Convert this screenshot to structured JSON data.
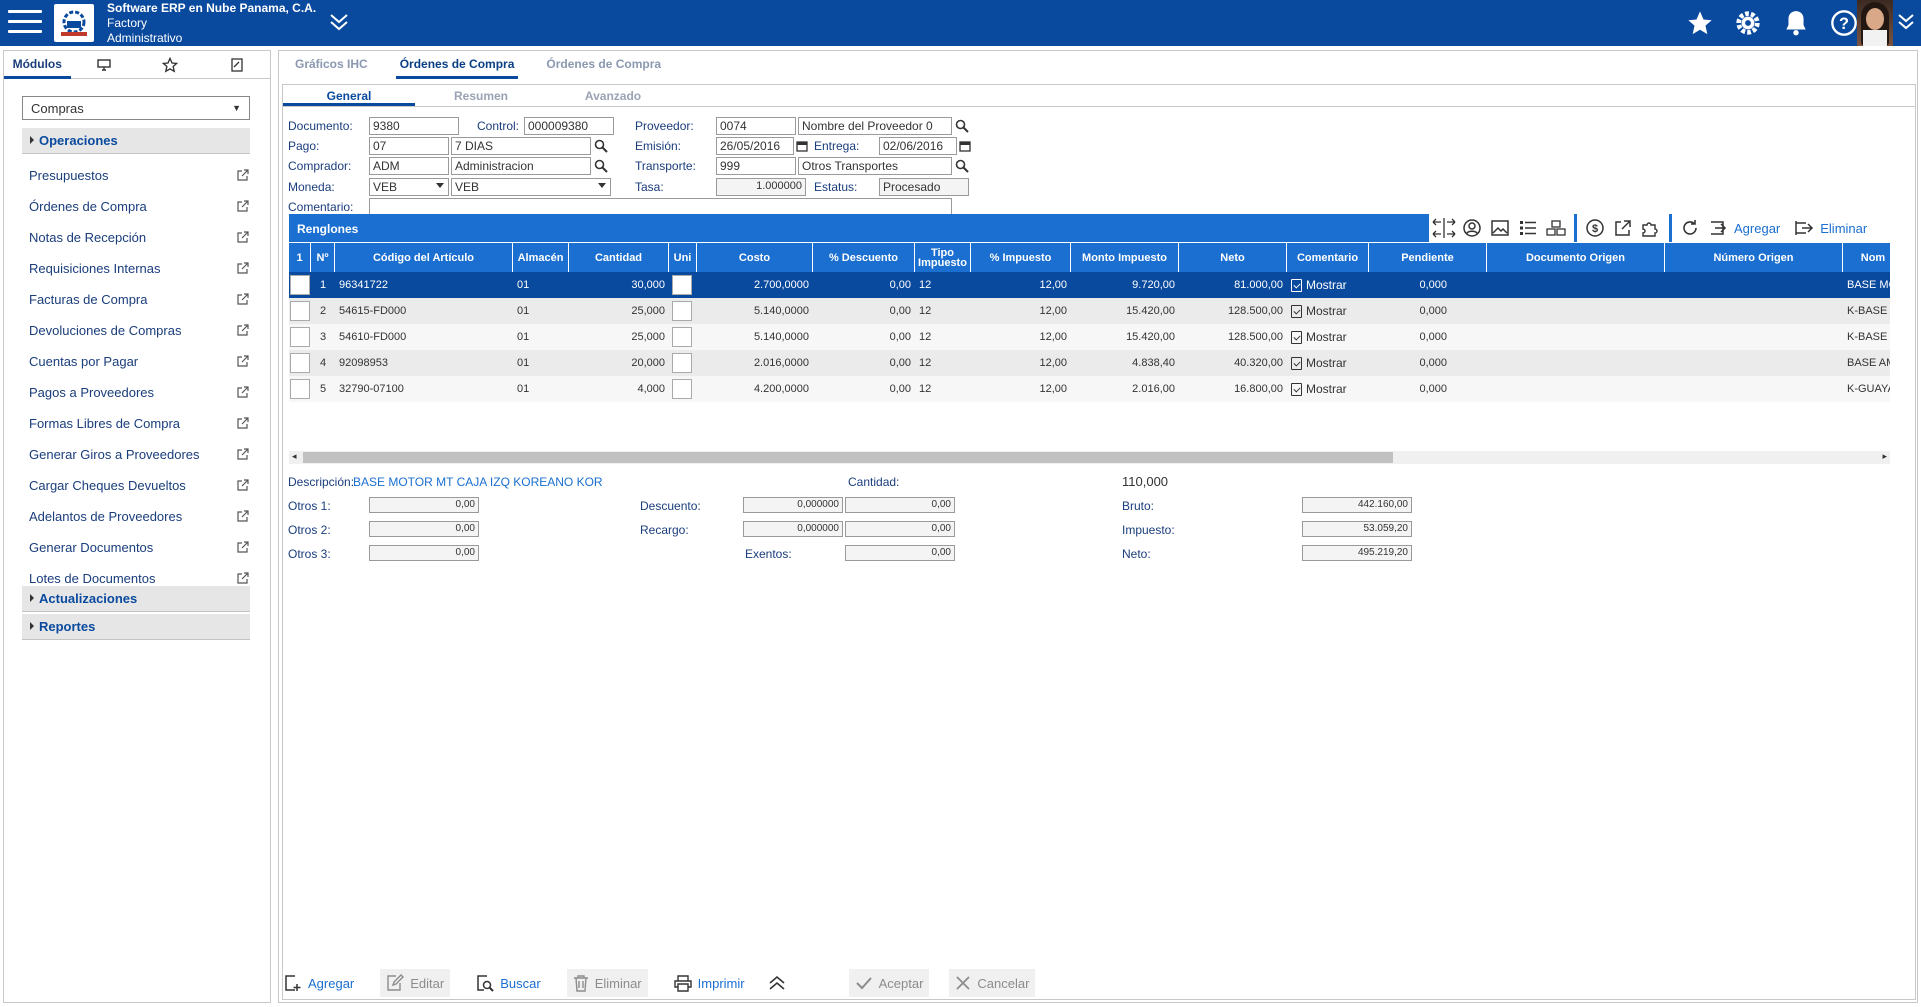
{
  "header": {
    "company": "Software ERP en Nube Panama, C.A.",
    "factory": "Factory",
    "role": "Administrativo"
  },
  "sidebar": {
    "tabs": [
      "Módulos",
      "monitor-icon",
      "star-icon",
      "notes-icon"
    ],
    "module": "Compras",
    "sections": [
      "Operaciones",
      "Actualizaciones",
      "Reportes"
    ],
    "items": [
      "Presupuestos",
      "Órdenes de Compra",
      "Notas de Recepción",
      "Requisiciones Internas",
      "Facturas de Compra",
      "Devoluciones de Compras",
      "Cuentas por Pagar",
      "Pagos a Proveedores",
      "Formas Libres de Compra",
      "Generar Giros a Proveedores",
      "Cargar Cheques Devueltos",
      "Adelantos de Proveedores",
      "Generar Documentos",
      "Lotes de Documentos"
    ]
  },
  "main_tabs": [
    "Gráficos IHC",
    "Órdenes de Compra",
    "Órdenes de Compra"
  ],
  "sub_tabs": [
    "General",
    "Resumen",
    "Avanzado"
  ],
  "form": {
    "documento_label": "Documento:",
    "documento": "9380",
    "control_label": "Control:",
    "control": "000009380",
    "proveedor_label": "Proveedor:",
    "proveedor_code": "0074",
    "proveedor_name": "Nombre del Proveedor 0",
    "pago_label": "Pago:",
    "pago_code": "07",
    "pago_desc": "7 DIAS",
    "emision_label": "Emisión:",
    "emision": "26/05/2016",
    "entrega_label": "Entrega:",
    "entrega": "02/06/2016",
    "comprador_label": "Comprador:",
    "comprador_code": "ADM",
    "comprador_name": "Administracion",
    "transporte_label": "Transporte:",
    "transporte_code": "999",
    "transporte_name": "Otros Transportes",
    "moneda_label": "Moneda:",
    "moneda_code": "VEB",
    "moneda_name": "VEB",
    "tasa_label": "Tasa:",
    "tasa": "1.000000",
    "estatus_label": "Estatus:",
    "estatus": "Procesado",
    "comentario_label": "Comentario:",
    "comentario": ""
  },
  "grid": {
    "title": "Renglones",
    "toolbar": {
      "agregar": "Agregar",
      "eliminar": "Eliminar"
    },
    "columns": [
      "1",
      "Nº",
      "Código del Artículo",
      "Almacén",
      "Cantidad",
      "Uni",
      "Costo",
      "% Descuento",
      "Tipo Impuesto",
      "% Impuesto",
      "Monto Impuesto",
      "Neto",
      "Comentario",
      "Pendiente",
      "Documento Origen",
      "Número Origen",
      "Nom"
    ],
    "rows": [
      {
        "n": "1",
        "codigo": "96341722",
        "almacen": "01",
        "cantidad": "30,000",
        "costo": "2.700,0000",
        "descuento": "0,00",
        "tipo": "12",
        "impuesto": "12,00",
        "monto": "9.720,00",
        "neto": "81.000,00",
        "comentario": "Mostrar",
        "pendiente": "0,000",
        "nombre": "BASE MOTOR"
      },
      {
        "n": "2",
        "codigo": "54615-FD000",
        "almacen": "01",
        "cantidad": "25,000",
        "costo": "5.140,0000",
        "descuento": "0,00",
        "tipo": "12",
        "impuesto": "12,00",
        "monto": "15.420,00",
        "neto": "128.500,00",
        "comentario": "Mostrar",
        "pendiente": "0,000",
        "nombre": "K-BASE AMOR"
      },
      {
        "n": "3",
        "codigo": "54610-FD000",
        "almacen": "01",
        "cantidad": "25,000",
        "costo": "5.140,0000",
        "descuento": "0,00",
        "tipo": "12",
        "impuesto": "12,00",
        "monto": "15.420,00",
        "neto": "128.500,00",
        "comentario": "Mostrar",
        "pendiente": "0,000",
        "nombre": "K-BASE AMOR"
      },
      {
        "n": "4",
        "codigo": "92098953",
        "almacen": "01",
        "cantidad": "20,000",
        "costo": "2.016,0000",
        "descuento": "0,00",
        "tipo": "12",
        "impuesto": "12,00",
        "monto": "4.838,40",
        "neto": "40.320,00",
        "comentario": "Mostrar",
        "pendiente": "0,000",
        "nombre": "BASE AMORT"
      },
      {
        "n": "5",
        "codigo": "32790-07100",
        "almacen": "01",
        "cantidad": "4,000",
        "costo": "4.200,0000",
        "descuento": "0,00",
        "tipo": "12",
        "impuesto": "12,00",
        "monto": "2.016,00",
        "neto": "16.800,00",
        "comentario": "Mostrar",
        "pendiente": "0,000",
        "nombre": "K-GUAYA ACE"
      }
    ]
  },
  "totals": {
    "descripcion_label": "Descripción:",
    "descripcion": "BASE MOTOR MT CAJA IZQ KOREANO KOR",
    "cantidad_label": "Cantidad:",
    "cantidad": "110,000",
    "otros1_label": "Otros 1:",
    "otros1": "0,00",
    "otros2_label": "Otros 2:",
    "otros2": "0,00",
    "otros3_label": "Otros 3:",
    "otros3": "0,00",
    "descuento_label": "Descuento:",
    "descuento_pct": "0,000000",
    "descuento": "0,00",
    "recargo_label": "Recargo:",
    "recargo_pct": "0,000000",
    "recargo": "0,00",
    "exentos_label": "Exentos:",
    "exentos": "0,00",
    "bruto_label": "Bruto:",
    "bruto": "442.160,00",
    "impuesto_label": "Impuesto:",
    "impuesto": "53.059,20",
    "neto_label": "Neto:",
    "neto": "495.219,20"
  },
  "footer": {
    "agregar": "Agregar",
    "editar": "Editar",
    "buscar": "Buscar",
    "eliminar": "Eliminar",
    "imprimir": "Imprimir",
    "aceptar": "Aceptar",
    "cancelar": "Cancelar"
  }
}
